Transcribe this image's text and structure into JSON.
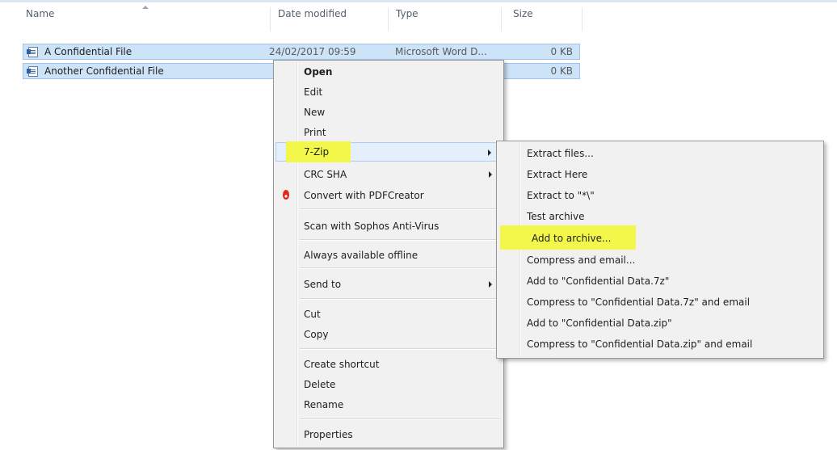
{
  "columns": {
    "name": "Name",
    "date": "Date modified",
    "type": "Type",
    "size": "Size"
  },
  "files": [
    {
      "name": "A Confidential File",
      "date": "24/02/2017 09:59",
      "type": "Microsoft Word D...",
      "size": "0 KB"
    },
    {
      "name": "Another Confidential File",
      "date": "",
      "type": "",
      "size": "0 KB"
    }
  ],
  "context_menu": {
    "open": "Open",
    "edit": "Edit",
    "new": "New",
    "print": "Print",
    "seven_zip": "7-Zip",
    "crc_sha": "CRC SHA",
    "convert_pdf": "Convert with PDFCreator",
    "scan": "Scan with Sophos Anti-Virus",
    "offline": "Always available offline",
    "send_to": "Send to",
    "cut": "Cut",
    "copy": "Copy",
    "create_shortcut": "Create shortcut",
    "delete": "Delete",
    "rename": "Rename",
    "properties": "Properties"
  },
  "submenu_7zip": {
    "extract_files": "Extract files...",
    "extract_here": "Extract Here",
    "extract_to": "Extract to \"*\\\"",
    "test_archive": "Test archive",
    "add_to_archive": "Add to archive...",
    "compress_email": "Compress and email...",
    "add_7z": "Add to \"Confidential Data.7z\"",
    "compress_7z_email": "Compress to \"Confidential Data.7z\" and email",
    "add_zip": "Add to \"Confidential Data.zip\"",
    "compress_zip_email": "Compress to \"Confidential Data.zip\" and email"
  },
  "icons": [
    "word-doc-icon",
    "pdfcreator-icon",
    "submenu-arrow-icon",
    "sort-arrow-icon"
  ],
  "colors": {
    "highlight": "#f2f74a",
    "selection": "#cde3f7",
    "menu_bg": "#f1f1f1"
  }
}
